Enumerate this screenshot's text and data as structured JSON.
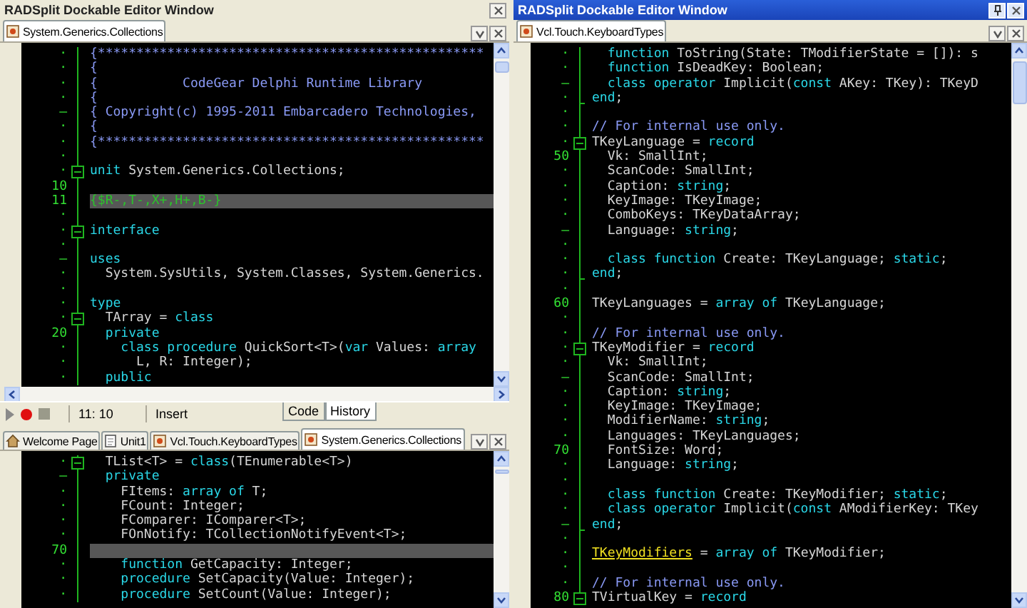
{
  "left_top": {
    "title": "RADSplit Dockable Editor Window",
    "active": false,
    "tabs": [
      {
        "label": "System.Generics.Collections",
        "kind": "source",
        "selected": true
      }
    ],
    "editor": {
      "lines": [
        {
          "gutter": "·",
          "kind": "plain",
          "current": false,
          "tokens": [
            {
              "kind": "cm",
              "text": "{**************************************************"
            }
          ]
        },
        {
          "gutter": "·",
          "kind": "plain",
          "current": false,
          "tokens": [
            {
              "kind": "cm",
              "text": "{"
            }
          ]
        },
        {
          "gutter": "·",
          "kind": "plain",
          "current": false,
          "tokens": [
            {
              "kind": "cm",
              "text": "{           CodeGear Delphi Runtime Library"
            }
          ]
        },
        {
          "gutter": "·",
          "kind": "plain",
          "current": false,
          "tokens": [
            {
              "kind": "cm",
              "text": "{"
            }
          ]
        },
        {
          "gutter": "–",
          "kind": "plain",
          "current": false,
          "tokens": [
            {
              "kind": "cm",
              "text": "{ Copyright(c) 1995-2011 Embarcadero Technologies,"
            }
          ]
        },
        {
          "gutter": "·",
          "kind": "plain",
          "current": false,
          "tokens": [
            {
              "kind": "cm",
              "text": "{"
            }
          ]
        },
        {
          "gutter": "·",
          "kind": "plain",
          "current": false,
          "tokens": [
            {
              "kind": "cm",
              "text": "{**************************************************"
            }
          ]
        },
        {
          "gutter": "·",
          "kind": "plain",
          "current": false
        },
        {
          "gutter": "·",
          "kind": "fold",
          "current": false,
          "tokens": [
            {
              "kind": "kw",
              "text": "unit"
            },
            {
              "kind": "id",
              "text": " System.Generics.Collections;"
            }
          ]
        },
        {
          "gutter": "10",
          "kind": "plain",
          "current": false
        },
        {
          "gutter": "11",
          "kind": "plain",
          "current": true,
          "tokens": [
            {
              "kind": "dir",
              "text": "{$R-,T-,X+,H+,B-}"
            }
          ]
        },
        {
          "gutter": "·",
          "kind": "plain",
          "current": false
        },
        {
          "gutter": "·",
          "kind": "fold",
          "current": false,
          "tokens": [
            {
              "kind": "kw",
              "text": "interface"
            }
          ]
        },
        {
          "gutter": "·",
          "kind": "plain",
          "current": false
        },
        {
          "gutter": "–",
          "kind": "plain",
          "current": false,
          "tokens": [
            {
              "kind": "kw",
              "text": "uses"
            }
          ]
        },
        {
          "gutter": "·",
          "kind": "plain",
          "current": false,
          "tokens": [
            {
              "kind": "id",
              "text": "  System.SysUtils, System.Classes, System.Generics."
            }
          ]
        },
        {
          "gutter": "·",
          "kind": "plain",
          "current": false
        },
        {
          "gutter": "·",
          "kind": "plain",
          "current": false,
          "tokens": [
            {
              "kind": "kw",
              "text": "type"
            }
          ]
        },
        {
          "gutter": "·",
          "kind": "fold",
          "current": false,
          "tokens": [
            {
              "kind": "id",
              "text": "  TArray = "
            },
            {
              "kind": "kw",
              "text": "class"
            }
          ]
        },
        {
          "gutter": "20",
          "kind": "plain",
          "current": false,
          "tokens": [
            {
              "kind": "kw",
              "text": "  private"
            }
          ]
        },
        {
          "gutter": "·",
          "kind": "plain",
          "current": false,
          "tokens": [
            {
              "kind": "kw",
              "text": "    class procedure"
            },
            {
              "kind": "id",
              "text": " QuickSort<T>("
            },
            {
              "kind": "kw",
              "text": "var"
            },
            {
              "kind": "id",
              "text": " Values: "
            },
            {
              "kind": "kw",
              "text": "array"
            }
          ]
        },
        {
          "gutter": "·",
          "kind": "plain",
          "current": false,
          "tokens": [
            {
              "kind": "id",
              "text": "      L, R: Integer);"
            }
          ]
        },
        {
          "gutter": "·",
          "kind": "plain",
          "current": false,
          "tokens": [
            {
              "kind": "kw",
              "text": "  public"
            }
          ]
        }
      ]
    },
    "status_bar": {
      "position": "11: 10",
      "mode": "Insert",
      "view_tabs": [
        {
          "label": "Code",
          "selected": true
        },
        {
          "label": "History",
          "selected": false
        }
      ]
    }
  },
  "left_bottom": {
    "tabs": [
      {
        "label": "Welcome Page",
        "kind": "welcome",
        "selected": false
      },
      {
        "label": "Unit1",
        "kind": "unit",
        "selected": false
      },
      {
        "label": "Vcl.Touch.KeyboardTypes",
        "kind": "source",
        "selected": false
      },
      {
        "label": "System.Generics.Collections",
        "kind": "source",
        "selected": true
      }
    ],
    "editor": {
      "lines": [
        {
          "gutter": "·",
          "kind": "fold",
          "current": false,
          "tokens": [
            {
              "kind": "id",
              "text": "  TList<T> = "
            },
            {
              "kind": "kw",
              "text": "class"
            },
            {
              "kind": "id",
              "text": "(TEnumerable<T>)"
            }
          ]
        },
        {
          "gutter": "–",
          "kind": "plain",
          "current": false,
          "tokens": [
            {
              "kind": "kw",
              "text": "  private"
            }
          ]
        },
        {
          "gutter": "·",
          "kind": "plain",
          "current": false,
          "tokens": [
            {
              "kind": "id",
              "text": "    FItems: "
            },
            {
              "kind": "kw",
              "text": "array of"
            },
            {
              "kind": "id",
              "text": " T;"
            }
          ]
        },
        {
          "gutter": "·",
          "kind": "plain",
          "current": false,
          "tokens": [
            {
              "kind": "id",
              "text": "    FCount: Integer;"
            }
          ]
        },
        {
          "gutter": "·",
          "kind": "plain",
          "current": false,
          "tokens": [
            {
              "kind": "id",
              "text": "    FComparer: IComparer<T>;"
            }
          ]
        },
        {
          "gutter": "·",
          "kind": "plain",
          "current": false,
          "tokens": [
            {
              "kind": "id",
              "text": "    FOnNotify: TCollectionNotifyEvent<T>;"
            }
          ]
        },
        {
          "gutter": "70",
          "kind": "plain",
          "current": true
        },
        {
          "gutter": "·",
          "kind": "plain",
          "current": false,
          "tokens": [
            {
              "kind": "kw",
              "text": "    function"
            },
            {
              "kind": "id",
              "text": " GetCapacity: Integer;"
            }
          ]
        },
        {
          "gutter": "·",
          "kind": "plain",
          "current": false,
          "tokens": [
            {
              "kind": "kw",
              "text": "    procedure"
            },
            {
              "kind": "id",
              "text": " SetCapacity(Value: Integer);"
            }
          ]
        },
        {
          "gutter": "·",
          "kind": "plain",
          "current": false,
          "tokens": [
            {
              "kind": "kw",
              "text": "    procedure"
            },
            {
              "kind": "id",
              "text": " SetCount(Value: Integer);"
            }
          ]
        }
      ]
    }
  },
  "right": {
    "title": "RADSplit Dockable Editor Window",
    "active": true,
    "tabs": [
      {
        "label": "Vcl.Touch.KeyboardTypes",
        "kind": "source",
        "selected": true
      }
    ],
    "editor": {
      "lines": [
        {
          "gutter": "·",
          "kind": "plain",
          "current": false,
          "tokens": [
            {
              "kind": "kw",
              "text": "  function"
            },
            {
              "kind": "id",
              "text": " ToString(State: TModifierState = []): s"
            }
          ]
        },
        {
          "gutter": "·",
          "kind": "plain",
          "current": false,
          "tokens": [
            {
              "kind": "kw",
              "text": "  function"
            },
            {
              "kind": "id",
              "text": " IsDeadKey: Boolean;"
            }
          ]
        },
        {
          "gutter": "–",
          "kind": "plain",
          "current": false,
          "tokens": [
            {
              "kind": "kw",
              "text": "  class operator"
            },
            {
              "kind": "id",
              "text": " Implicit("
            },
            {
              "kind": "kw",
              "text": "const"
            },
            {
              "kind": "id",
              "text": " AKey: TKey): TKeyD"
            }
          ]
        },
        {
          "gutter": "·",
          "kind": "fold_end",
          "current": false,
          "tokens": [
            {
              "kind": "kw",
              "text": "end"
            },
            {
              "kind": "id",
              "text": ";"
            }
          ]
        },
        {
          "gutter": "·",
          "kind": "plain",
          "current": false
        },
        {
          "gutter": "·",
          "kind": "plain",
          "current": false,
          "tokens": [
            {
              "kind": "cm",
              "text": "// For internal use only."
            }
          ]
        },
        {
          "gutter": "·",
          "kind": "fold",
          "current": false,
          "tokens": [
            {
              "kind": "id",
              "text": "TKeyLanguage = "
            },
            {
              "kind": "kw",
              "text": "record"
            }
          ]
        },
        {
          "gutter": "50",
          "kind": "plain",
          "current": false,
          "tokens": [
            {
              "kind": "id",
              "text": "  Vk: SmallInt;"
            }
          ]
        },
        {
          "gutter": "·",
          "kind": "plain",
          "current": false,
          "tokens": [
            {
              "kind": "id",
              "text": "  ScanCode: SmallInt;"
            }
          ]
        },
        {
          "gutter": "·",
          "kind": "plain",
          "current": false,
          "tokens": [
            {
              "kind": "id",
              "text": "  Caption: "
            },
            {
              "kind": "kw",
              "text": "string"
            },
            {
              "kind": "id",
              "text": ";"
            }
          ]
        },
        {
          "gutter": "·",
          "kind": "plain",
          "current": false,
          "tokens": [
            {
              "kind": "id",
              "text": "  KeyImage: TKeyImage;"
            }
          ]
        },
        {
          "gutter": "·",
          "kind": "plain",
          "current": false,
          "tokens": [
            {
              "kind": "id",
              "text": "  ComboKeys: TKeyDataArray;"
            }
          ]
        },
        {
          "gutter": "–",
          "kind": "plain",
          "current": false,
          "tokens": [
            {
              "kind": "id",
              "text": "  Language: "
            },
            {
              "kind": "kw",
              "text": "string"
            },
            {
              "kind": "id",
              "text": ";"
            }
          ]
        },
        {
          "gutter": "·",
          "kind": "plain",
          "current": false
        },
        {
          "gutter": "·",
          "kind": "plain",
          "current": false,
          "tokens": [
            {
              "kind": "kw",
              "text": "  class function"
            },
            {
              "kind": "id",
              "text": " Create: TKeyLanguage; "
            },
            {
              "kind": "kw",
              "text": "static"
            },
            {
              "kind": "id",
              "text": ";"
            }
          ]
        },
        {
          "gutter": "·",
          "kind": "fold_end",
          "current": false,
          "tokens": [
            {
              "kind": "kw",
              "text": "end"
            },
            {
              "kind": "id",
              "text": ";"
            }
          ]
        },
        {
          "gutter": "·",
          "kind": "plain",
          "current": false
        },
        {
          "gutter": "60",
          "kind": "plain",
          "current": false,
          "tokens": [
            {
              "kind": "id",
              "text": "TKeyLanguages = "
            },
            {
              "kind": "kw",
              "text": "array of"
            },
            {
              "kind": "id",
              "text": " TKeyLanguage;"
            }
          ]
        },
        {
          "gutter": "·",
          "kind": "plain",
          "current": false
        },
        {
          "gutter": "·",
          "kind": "plain",
          "current": false,
          "tokens": [
            {
              "kind": "cm",
              "text": "// For internal use only."
            }
          ]
        },
        {
          "gutter": "·",
          "kind": "fold",
          "current": false,
          "tokens": [
            {
              "kind": "id",
              "text": "TKeyModifier = "
            },
            {
              "kind": "kw",
              "text": "record"
            }
          ]
        },
        {
          "gutter": "·",
          "kind": "plain",
          "current": false,
          "tokens": [
            {
              "kind": "id",
              "text": "  Vk: SmallInt;"
            }
          ]
        },
        {
          "gutter": "–",
          "kind": "plain",
          "current": false,
          "tokens": [
            {
              "kind": "id",
              "text": "  ScanCode: SmallInt;"
            }
          ]
        },
        {
          "gutter": "·",
          "kind": "plain",
          "current": false,
          "tokens": [
            {
              "kind": "id",
              "text": "  Caption: "
            },
            {
              "kind": "kw",
              "text": "string"
            },
            {
              "kind": "id",
              "text": ";"
            }
          ]
        },
        {
          "gutter": "·",
          "kind": "plain",
          "current": false,
          "tokens": [
            {
              "kind": "id",
              "text": "  KeyImage: TKeyImage;"
            }
          ]
        },
        {
          "gutter": "·",
          "kind": "plain",
          "current": false,
          "tokens": [
            {
              "kind": "id",
              "text": "  ModifierName: "
            },
            {
              "kind": "kw",
              "text": "string"
            },
            {
              "kind": "id",
              "text": ";"
            }
          ]
        },
        {
          "gutter": "·",
          "kind": "plain",
          "current": false,
          "tokens": [
            {
              "kind": "id",
              "text": "  Languages: TKeyLanguages;"
            }
          ]
        },
        {
          "gutter": "70",
          "kind": "plain",
          "current": false,
          "tokens": [
            {
              "kind": "id",
              "text": "  FontSize: Word;"
            }
          ]
        },
        {
          "gutter": "·",
          "kind": "plain",
          "current": false,
          "tokens": [
            {
              "kind": "id",
              "text": "  Language: "
            },
            {
              "kind": "kw",
              "text": "string"
            },
            {
              "kind": "id",
              "text": ";"
            }
          ]
        },
        {
          "gutter": "·",
          "kind": "plain",
          "current": false
        },
        {
          "gutter": "·",
          "kind": "plain",
          "current": false,
          "tokens": [
            {
              "kind": "kw",
              "text": "  class function"
            },
            {
              "kind": "id",
              "text": " Create: TKeyModifier; "
            },
            {
              "kind": "kw",
              "text": "static"
            },
            {
              "kind": "id",
              "text": ";"
            }
          ]
        },
        {
          "gutter": "·",
          "kind": "plain",
          "current": false,
          "tokens": [
            {
              "kind": "kw",
              "text": "  class operator"
            },
            {
              "kind": "id",
              "text": " Implicit("
            },
            {
              "kind": "kw",
              "text": "const"
            },
            {
              "kind": "id",
              "text": " AModifierKey: TKey"
            }
          ]
        },
        {
          "gutter": "–",
          "kind": "fold_end",
          "current": false,
          "tokens": [
            {
              "kind": "kw",
              "text": "end"
            },
            {
              "kind": "id",
              "text": ";"
            }
          ]
        },
        {
          "gutter": "·",
          "kind": "plain",
          "current": false
        },
        {
          "gutter": "·",
          "kind": "plain",
          "current": false,
          "tokens": [
            {
              "kind": "link",
              "text": "TKeyModifiers"
            },
            {
              "kind": "id",
              "text": " = "
            },
            {
              "kind": "kw",
              "text": "array of"
            },
            {
              "kind": "id",
              "text": " TKeyModifier;"
            }
          ]
        },
        {
          "gutter": "·",
          "kind": "plain",
          "current": false
        },
        {
          "gutter": "·",
          "kind": "plain",
          "current": false,
          "tokens": [
            {
              "kind": "cm",
              "text": "// For internal use only."
            }
          ]
        },
        {
          "gutter": "80",
          "kind": "fold",
          "current": false,
          "tokens": [
            {
              "kind": "id",
              "text": "TVirtualKey = "
            },
            {
              "kind": "kw",
              "text": "record"
            }
          ]
        }
      ]
    }
  }
}
